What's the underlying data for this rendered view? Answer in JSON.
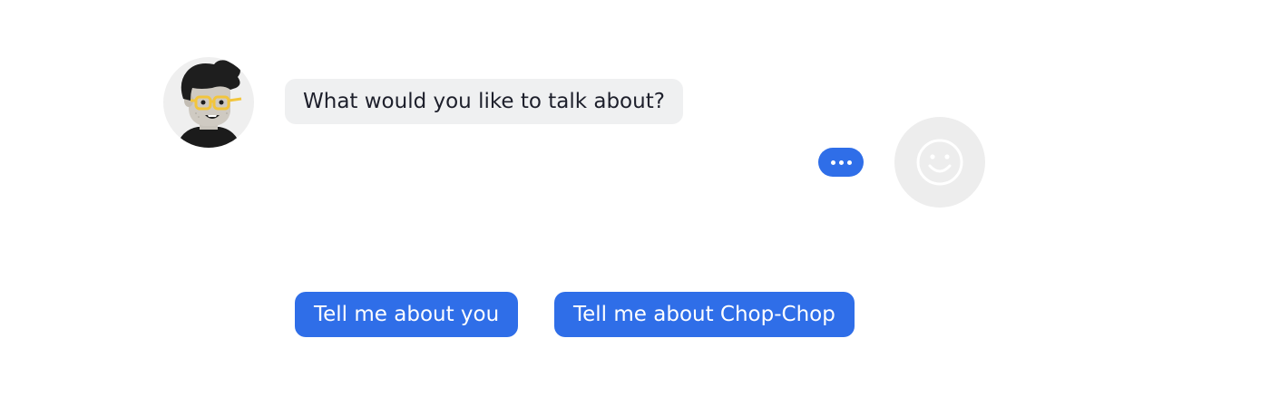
{
  "chat": {
    "bot_message": "What would you like to talk about?",
    "typing_indicator_icon": "ellipsis-icon",
    "bot_avatar_icon": "cartoon-person-with-glasses",
    "user_avatar_icon": "smiley-face-icon"
  },
  "quick_replies": [
    {
      "label": "Tell me about you"
    },
    {
      "label": "Tell me about Chop-Chop"
    }
  ],
  "colors": {
    "accent": "#2f6ee8",
    "bot_bubble_bg": "#eff0f1",
    "avatar_bg": "#efefef",
    "glasses": "#f2c53d"
  }
}
